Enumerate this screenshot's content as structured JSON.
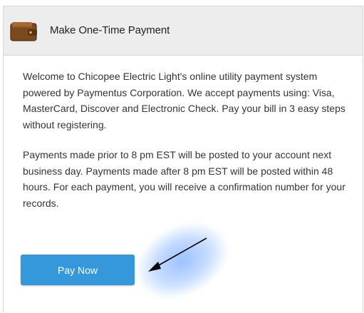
{
  "panel": {
    "title": "Make One-Time Payment",
    "icon": "wallet-icon",
    "paragraphs": [
      "Welcome to Chicopee Electric Light's online utility payment system powered by Paymentus Corporation. We accept payments using: Visa, MasterCard, Discover and Electronic Check. Pay your bill in 3 easy steps without registering.",
      "Payments made prior to 8 pm EST will be posted to your account next business day. Payments made after 8 pm EST will be posted within 48 hours. For each payment, you will receive a confirmation number for your records."
    ],
    "button_label": "Pay Now"
  },
  "colors": {
    "button": "#3498db",
    "header_bg": "#ededed",
    "annotation_arrow": "#000000",
    "annotation_highlight": "#78aaff"
  }
}
